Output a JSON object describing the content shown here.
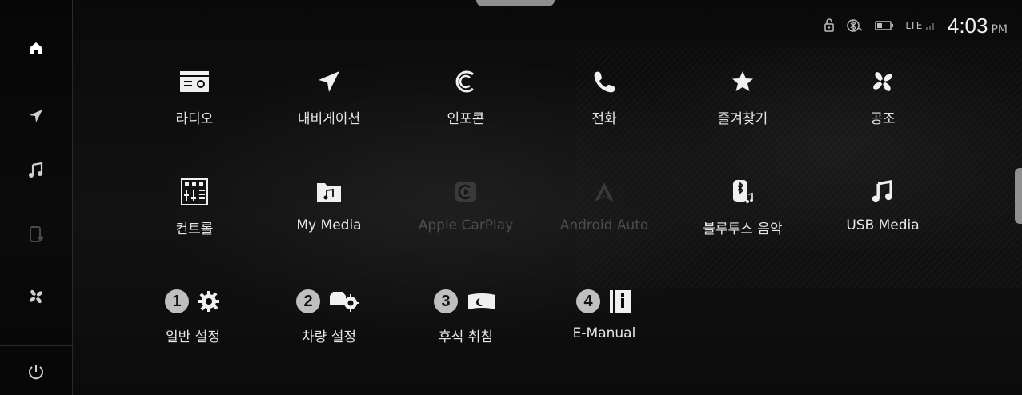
{
  "status": {
    "network": "LTE",
    "time": "4:03",
    "ampm": "PM"
  },
  "sidebar": {
    "items": [
      {
        "icon": "home-icon",
        "active": true
      },
      {
        "icon": "navigation-arrow-icon",
        "active": false
      },
      {
        "icon": "music-note-icon",
        "active": false
      },
      {
        "icon": "phone-projection-icon",
        "active": false
      },
      {
        "icon": "fan-icon",
        "active": false
      },
      {
        "icon": "power-icon",
        "active": false
      }
    ]
  },
  "grid": {
    "row1": [
      {
        "label": "라디오",
        "icon": "radio-icon",
        "enabled": true
      },
      {
        "label": "내비게이션",
        "icon": "navigation-arrow-icon",
        "enabled": true
      },
      {
        "label": "인포콘",
        "icon": "infoconn-icon",
        "enabled": true
      },
      {
        "label": "전화",
        "icon": "phone-icon",
        "enabled": true
      },
      {
        "label": "즐겨찾기",
        "icon": "star-icon",
        "enabled": true
      },
      {
        "label": "공조",
        "icon": "fan-icon",
        "enabled": true
      }
    ],
    "row2": [
      {
        "label": "컨트롤",
        "icon": "control-panel-icon",
        "enabled": true
      },
      {
        "label": "My Media",
        "icon": "media-folder-icon",
        "enabled": true
      },
      {
        "label": "Apple CarPlay",
        "icon": "carplay-icon",
        "enabled": false
      },
      {
        "label": "Android Auto",
        "icon": "android-auto-icon",
        "enabled": false
      },
      {
        "label": "블루투스 음악",
        "icon": "bluetooth-music-icon",
        "enabled": true
      },
      {
        "label": "USB Media",
        "icon": "usb-music-icon",
        "enabled": true
      }
    ],
    "row3": [
      {
        "badge": "1",
        "label": "일반 설정",
        "icon": "gear-icon"
      },
      {
        "badge": "2",
        "label": "차량 설정",
        "icon": "vehicle-settings-icon"
      },
      {
        "badge": "3",
        "label": "후석 취침",
        "icon": "rear-sleep-icon"
      },
      {
        "badge": "4",
        "label": "E-Manual",
        "icon": "manual-info-icon"
      }
    ]
  },
  "colors": {
    "background": "#0b0b0b",
    "text": "#e6e6e6",
    "disabled_text": "#4d4d4d",
    "badge": "#bfbfbf"
  }
}
